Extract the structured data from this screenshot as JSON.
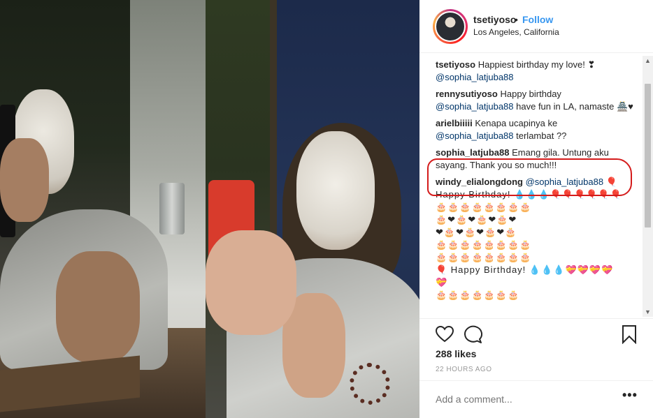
{
  "post": {
    "username": "tsetiyoso",
    "separator": "•",
    "follow_label": "Follow",
    "location": "Los Angeles, California",
    "avatar_icon": "profile-photo"
  },
  "comments": [
    {
      "user": "tsetiyoso",
      "text": "Happiest birthday my love! ❣",
      "mention": "@sophia_latjuba88",
      "after": ""
    },
    {
      "user": "rennysutiyoso",
      "text": "Happy birthday",
      "mention": "@sophia_latjuba88",
      "after": "have fun in LA, namaste 🏯♥"
    },
    {
      "user": "arielbiiiii",
      "text": "Kenapa ucapinya ke",
      "mention": "@sophia_latjuba88",
      "after": "terlambat ??"
    },
    {
      "user": "sophia_latjuba88",
      "text": "Emang gila. Untung aku sayang. Thank you so much!!!",
      "mention": "",
      "after": ""
    },
    {
      "user": "windy_elialongdong",
      "text": "",
      "mention": "@sophia_latjuba88",
      "after": "🎈"
    }
  ],
  "birthday_lines": [
    "Happy Birthday! 💧💧💧🎈🎈🎈🎈🎈🎈",
    "🎂🎂🎂🎂🎂🎂🎂🎂",
    "🎂❤🎂❤🎂❤🎂❤",
    "❤🎂❤🎂❤🎂❤🎂",
    "🎂🎂🎂🎂🎂🎂🎂🎂",
    "🎂🎂🎂🎂🎂🎂🎂🎂",
    "🎈 Happy Birthday! 💧💧💧💝💝💝💝",
    "💝",
    "🎂🎂🎂🎂🎂🎂🎂"
  ],
  "actions": {
    "like_icon": "heart-icon",
    "comment_icon": "comment-icon",
    "save_icon": "bookmark-icon"
  },
  "likes": "288 likes",
  "timestamp": "22 HOURS AGO",
  "add_comment_placeholder": "Add a comment...",
  "more_label": "•••",
  "scroll": {
    "up": "▲",
    "down": "▼"
  },
  "colors": {
    "link": "#3897f0",
    "mention": "#003569",
    "highlight": "#d41b1b"
  }
}
